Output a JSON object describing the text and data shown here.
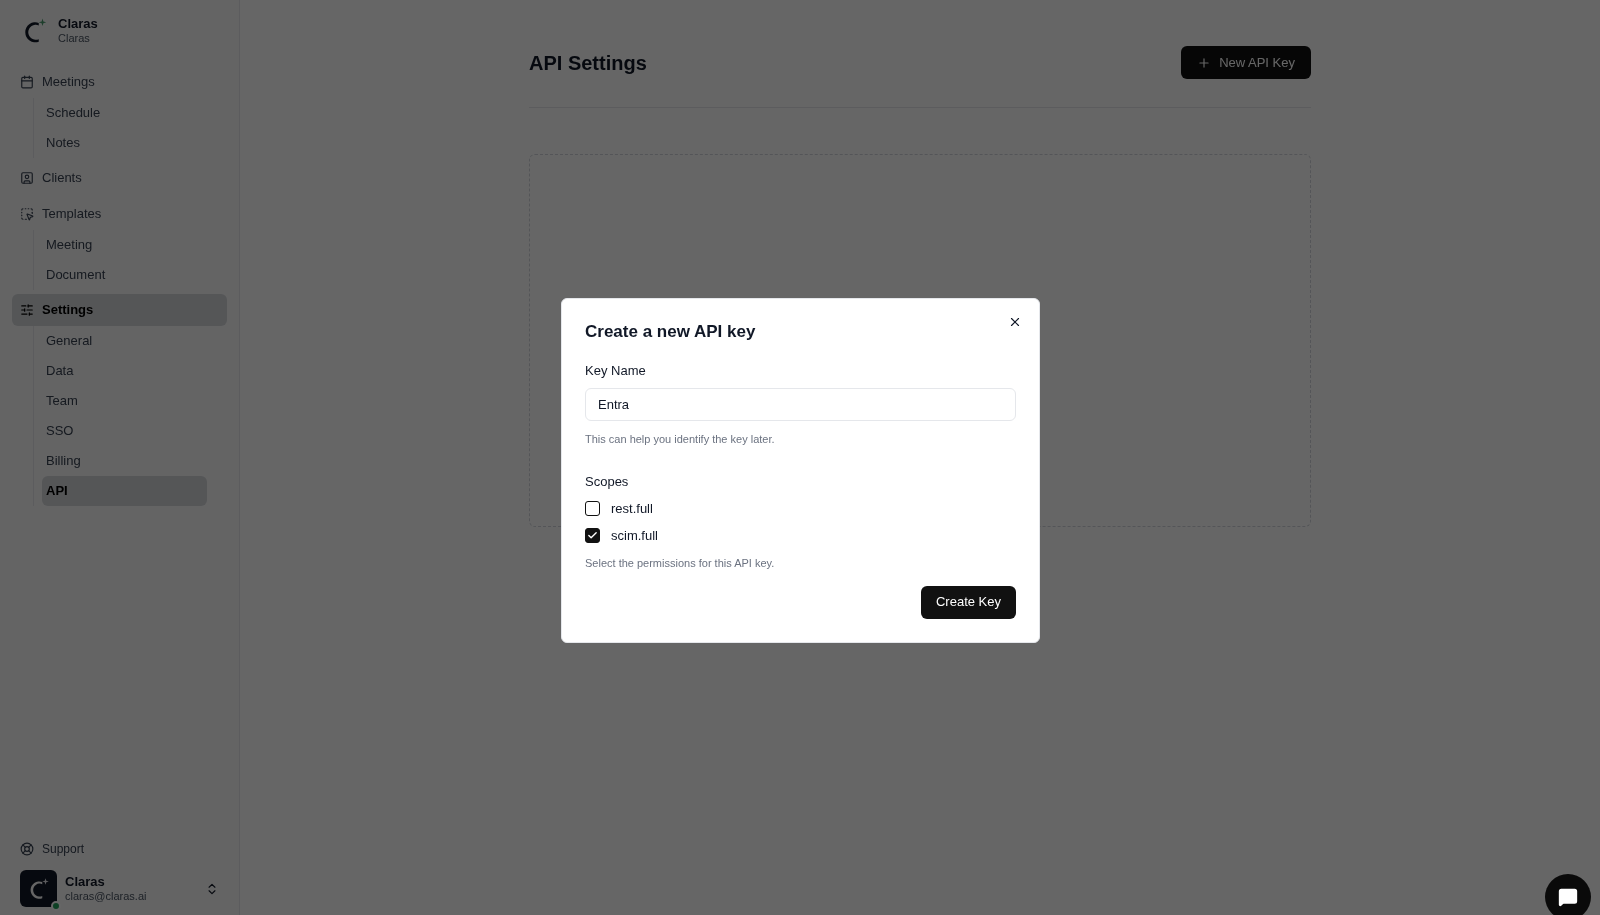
{
  "workspace": {
    "name": "Claras",
    "subtitle": "Claras"
  },
  "nav": [
    {
      "label": "Meetings",
      "selected": false,
      "children": [
        {
          "label": "Schedule",
          "selected": false
        },
        {
          "label": "Notes",
          "selected": false
        }
      ]
    },
    {
      "label": "Clients",
      "selected": false
    },
    {
      "label": "Templates",
      "selected": false,
      "children": [
        {
          "label": "Meeting",
          "selected": false
        },
        {
          "label": "Document",
          "selected": false
        }
      ]
    },
    {
      "label": "Settings",
      "selected": true,
      "children": [
        {
          "label": "General",
          "selected": false
        },
        {
          "label": "Data",
          "selected": false
        },
        {
          "label": "Team",
          "selected": false
        },
        {
          "label": "SSO",
          "selected": false
        },
        {
          "label": "Billing",
          "selected": false
        },
        {
          "label": "API",
          "selected": true
        }
      ]
    }
  ],
  "support": "Support",
  "user": {
    "name": "Claras",
    "email": "claras@claras.ai",
    "online": true
  },
  "page": {
    "title": "API Settings",
    "new_button": "New API Key"
  },
  "dialog": {
    "title": "Create a new API key",
    "key_label": "Key Name",
    "key_value": "Entra",
    "key_hint": "This can help you identify the key later.",
    "scopes_label": "Scopes",
    "scopes": [
      {
        "label": "rest.full",
        "checked": false
      },
      {
        "label": "scim.full",
        "checked": true
      }
    ],
    "scopes_hint": "Select the permissions for this API key.",
    "submit": "Create Key"
  }
}
